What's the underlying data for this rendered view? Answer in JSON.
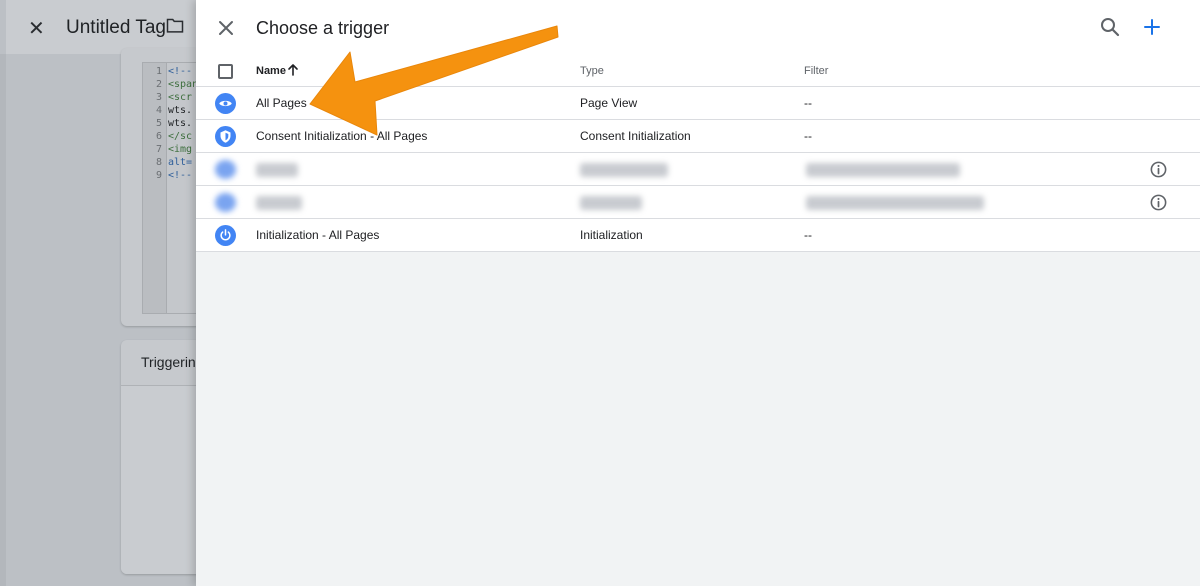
{
  "background_editor": {
    "close_icon": "close-icon",
    "title": "Untitled Tag",
    "folder_icon": "folder-icon",
    "code_lines": [
      {
        "num": "1",
        "text": "<!--"
      },
      {
        "num": "2",
        "text": "<span"
      },
      {
        "num": "3",
        "text": "<scr"
      },
      {
        "num": "4",
        "text": "wts."
      },
      {
        "num": "5",
        "text": "wts."
      },
      {
        "num": "6",
        "text": "</sc"
      },
      {
        "num": "7",
        "text": "<img"
      },
      {
        "num": "8",
        "text": "alt="
      },
      {
        "num": "9",
        "text": "<!--"
      }
    ],
    "triggering_label": "Triggerin"
  },
  "dialog": {
    "title": "Choose a trigger",
    "close_icon": "close-icon",
    "search_icon": "search-icon",
    "add_icon": "plus-icon",
    "accent_color": "#1a73e8",
    "columns": {
      "name": "Name",
      "type": "Type",
      "filter": "Filter"
    },
    "rows": [
      {
        "name": "All Pages",
        "type": "Page View",
        "filter": "--",
        "icon": "eye-icon"
      },
      {
        "name": "Consent Initialization - All Pages",
        "type": "Consent Initialization",
        "filter": "--",
        "icon": "shield-icon"
      },
      {
        "name": "",
        "type": "",
        "filter": "",
        "icon": "blurred-icon",
        "blurred": true
      },
      {
        "name": "",
        "type": "",
        "filter": "",
        "icon": "blurred-icon",
        "blurred": true
      },
      {
        "name": "Initialization - All Pages",
        "type": "Initialization",
        "filter": "--",
        "icon": "power-icon"
      }
    ]
  },
  "annotation": {
    "arrow_color": "#f5920f"
  }
}
